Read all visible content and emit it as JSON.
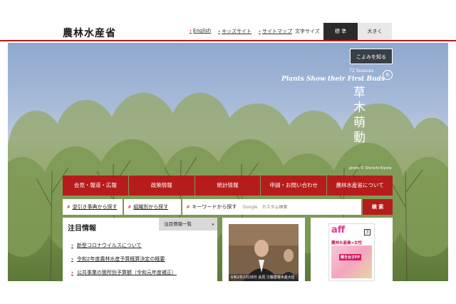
{
  "header": {
    "logo": "農林水産省",
    "links": [
      "English",
      "キッズサイト",
      "サイトマップ"
    ],
    "font_size_label": "文字サイズ",
    "font_size_standard": "標 準",
    "font_size_large": "大きく"
  },
  "season": {
    "button": "こよみを知る",
    "subtitle": "72 Seasons",
    "title": "Plants Show their First Buds",
    "number": "6",
    "kanji": "草木萌動",
    "credit": "photo © Shinichi Kiyota"
  },
  "global_nav": [
    "会見・報道・広報",
    "政策情報",
    "統計情報",
    "申請・お問い合わせ",
    "農林水産省について"
  ],
  "search": {
    "reverse_lookup": "逆引き事典から探す",
    "by_org": "組織別から探す",
    "keyword_label": "キーワードから探す",
    "google_label": "Google",
    "placeholder": "カスタム検索",
    "submit": "検 索"
  },
  "news": {
    "title": "注目情報",
    "all_link": "注目情報一覧",
    "items": [
      "新型コロナウイルスについて",
      "令和2年度農林水産予算概算決定の概要",
      "公共事業の箇所別予算額（令和元年度補正）"
    ]
  },
  "photo_card": {
    "caption": "令和2年2月28日 会見 江藤農林水産大臣"
  },
  "magazine": {
    "logo": "aff",
    "issue": "3",
    "title": "農林水産業×女性",
    "badge": "輝き女子FP"
  },
  "colors": {
    "accent_red": "#b71c1c",
    "dark_button": "#2b2b2b"
  }
}
